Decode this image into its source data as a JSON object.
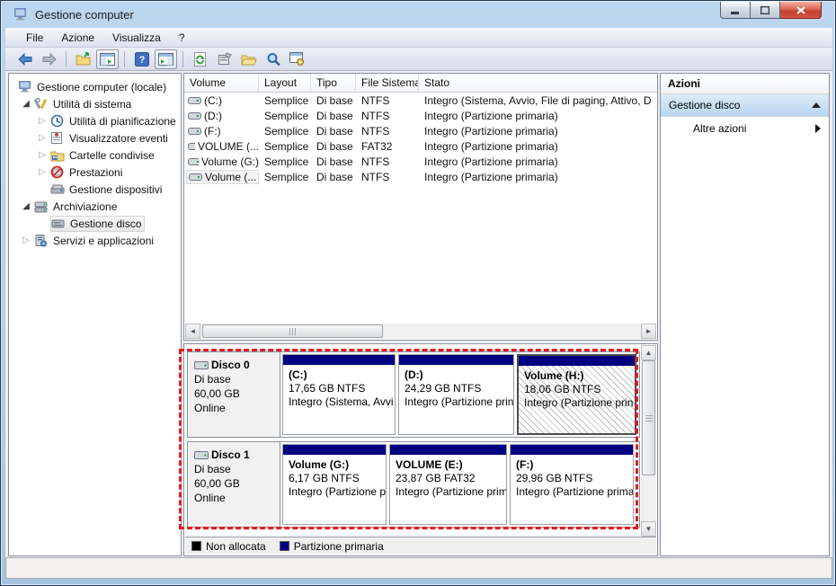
{
  "window": {
    "title": "Gestione computer"
  },
  "window_controls": {
    "minimize": "minimize",
    "maximize": "maximize",
    "close": "close"
  },
  "menu": {
    "items": [
      {
        "label": "File"
      },
      {
        "label": "Azione"
      },
      {
        "label": "Visualizza"
      },
      {
        "label": "?"
      }
    ]
  },
  "toolbar": {
    "icons": [
      "back-icon",
      "forward-icon",
      "folder-up-icon",
      "show-console-tree-icon",
      "help-icon",
      "show-action-pane-icon",
      "refresh-icon",
      "properties-icon",
      "open-folder-icon",
      "find-icon",
      "manage-icon"
    ]
  },
  "tree": {
    "items": [
      {
        "label": "Gestione computer (locale)",
        "icon": "computer-icon",
        "level": 0,
        "expander": "none",
        "selected": false
      },
      {
        "label": "Utilità di sistema",
        "icon": "system-tools-icon",
        "level": 1,
        "expander": "expanded",
        "selected": false
      },
      {
        "label": "Utilità di pianificazione",
        "icon": "task-scheduler-icon",
        "level": 2,
        "expander": "collapsed",
        "selected": false
      },
      {
        "label": "Visualizzatore eventi",
        "icon": "event-viewer-icon",
        "level": 2,
        "expander": "collapsed",
        "selected": false
      },
      {
        "label": "Cartelle condivise",
        "icon": "shared-folders-icon",
        "level": 2,
        "expander": "collapsed",
        "selected": false
      },
      {
        "label": "Prestazioni",
        "icon": "performance-icon",
        "level": 2,
        "expander": "collapsed",
        "selected": false
      },
      {
        "label": "Gestione dispositivi",
        "icon": "device-manager-icon",
        "level": 2,
        "expander": "none",
        "selected": false
      },
      {
        "label": "Archiviazione",
        "icon": "storage-icon",
        "level": 1,
        "expander": "expanded",
        "selected": false
      },
      {
        "label": "Gestione disco",
        "icon": "disk-management-icon",
        "level": 2,
        "expander": "none",
        "selected": true
      },
      {
        "label": "Servizi e applicazioni",
        "icon": "services-icon",
        "level": 1,
        "expander": "collapsed",
        "selected": false
      }
    ]
  },
  "volume_table": {
    "columns": [
      {
        "label": "Volume"
      },
      {
        "label": "Layout"
      },
      {
        "label": "Tipo"
      },
      {
        "label": "File Sistema"
      },
      {
        "label": "Stato"
      }
    ],
    "rows": [
      {
        "volume": "(C:)",
        "layout": "Semplice",
        "tipo": "Di base",
        "fs": "NTFS",
        "stato": "Integro (Sistema, Avvio, File di paging, Attivo, D"
      },
      {
        "volume": "(D:)",
        "layout": "Semplice",
        "tipo": "Di base",
        "fs": "NTFS",
        "stato": "Integro (Partizione primaria)"
      },
      {
        "volume": "(F:)",
        "layout": "Semplice",
        "tipo": "Di base",
        "fs": "NTFS",
        "stato": "Integro (Partizione primaria)"
      },
      {
        "volume": "VOLUME (...",
        "layout": "Semplice",
        "tipo": "Di base",
        "fs": "FAT32",
        "stato": "Integro (Partizione primaria)"
      },
      {
        "volume": "Volume (G:)",
        "layout": "Semplice",
        "tipo": "Di base",
        "fs": "NTFS",
        "stato": "Integro (Partizione primaria)"
      },
      {
        "volume": "Volume (...",
        "layout": "Semplice",
        "tipo": "Di base",
        "fs": "NTFS",
        "stato": "Integro (Partizione primaria)"
      }
    ]
  },
  "disks": [
    {
      "name": "Disco 0",
      "type": "Di base",
      "size": "60,00 GB",
      "status": "Online",
      "partitions": [
        {
          "name": "(C:)",
          "size": "17,65 GB NTFS",
          "status": "Integro (Sistema, Avvi"
        },
        {
          "name": "(D:)",
          "size": "24,29 GB NTFS",
          "status": "Integro (Partizione prin"
        },
        {
          "name": "Volume (H:)",
          "size": "18,06 GB NTFS",
          "status": "Integro (Partizione prin"
        }
      ]
    },
    {
      "name": "Disco 1",
      "type": "Di base",
      "size": "60,00 GB",
      "status": "Online",
      "partitions": [
        {
          "name": "Volume (G:)",
          "size": "6,17 GB NTFS",
          "status": "Integro (Partizione p"
        },
        {
          "name": "VOLUME (E:)",
          "size": "23,87 GB FAT32",
          "status": "Integro (Partizione prim"
        },
        {
          "name": "(F:)",
          "size": "29,96 GB NTFS",
          "status": "Integro (Partizione prima"
        }
      ]
    }
  ],
  "legend": [
    {
      "label": "Non allocata",
      "color": "#000000"
    },
    {
      "label": "Partizione primaria",
      "color": "#000080"
    }
  ],
  "actions": {
    "title": "Azioni",
    "group": "Gestione disco",
    "items": [
      {
        "label": "Altre azioni"
      }
    ]
  },
  "colors": {
    "titlebar": "#b5d2ee",
    "partition_bar": "#000080",
    "annotation": "#e8191f",
    "close_button": "#c1402f"
  }
}
